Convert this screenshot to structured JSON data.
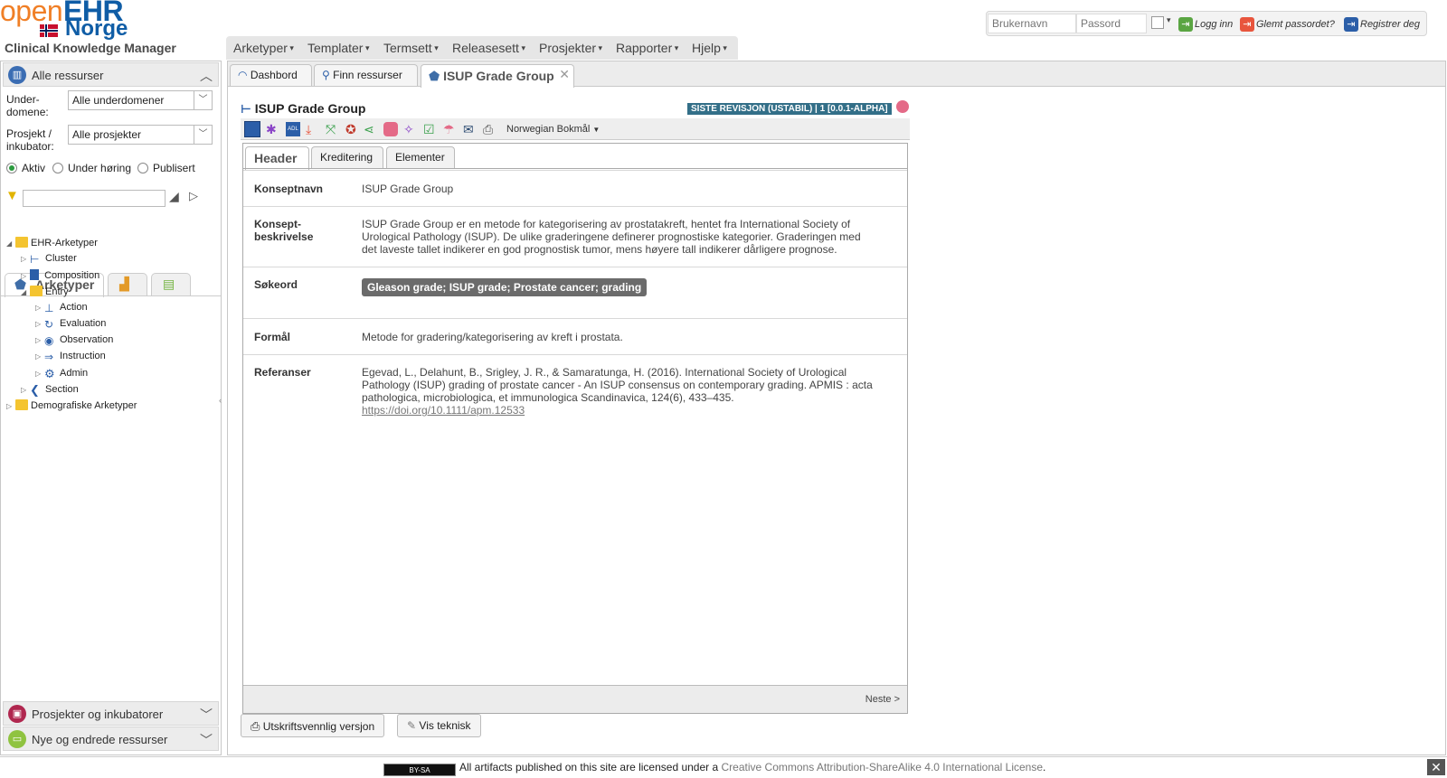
{
  "brand": {
    "logo_open": "open",
    "logo_ehr": "EHR",
    "logo_norge": "Norge",
    "app_title": "Clinical Knowledge Manager"
  },
  "login": {
    "username_placeholder": "Brukernavn",
    "password_placeholder": "Passord",
    "login_label": "Logg inn",
    "forgot_label": "Glemt passordet?",
    "register_label": "Registrer deg"
  },
  "menu": [
    "Arketyper",
    "Templater",
    "Termsett",
    "Releasesett",
    "Prosjekter",
    "Rapporter",
    "Hjelp"
  ],
  "left_panel": {
    "all_resources": "Alle ressurser",
    "subdomain_label": "Under-\ndomene:",
    "subdomain_value": "Alle underdomener",
    "project_label": "Prosjekt /\ninkubator:",
    "project_value": "Alle prosjekter",
    "radios": [
      {
        "label": "Aktiv",
        "checked": true
      },
      {
        "label": "Under høring",
        "checked": false
      },
      {
        "label": "Publisert",
        "checked": false
      }
    ],
    "tab_archetypes": "Arketyper",
    "tree": [
      {
        "label": "EHR-Arketyper",
        "icon": "folder-open-icon"
      },
      {
        "label": "Cluster",
        "icon": "cluster-icon"
      },
      {
        "label": "Composition",
        "icon": "composition-icon"
      },
      {
        "label": "Entry",
        "icon": "folder-open-icon"
      },
      {
        "label": "Action",
        "icon": "action-icon"
      },
      {
        "label": "Evaluation",
        "icon": "evaluation-icon"
      },
      {
        "label": "Observation",
        "icon": "observation-icon"
      },
      {
        "label": "Instruction",
        "icon": "instruction-icon"
      },
      {
        "label": "Admin",
        "icon": "gear-icon"
      },
      {
        "label": "Section",
        "icon": "section-icon"
      },
      {
        "label": "Demografiske Arketyper",
        "icon": "folder-icon"
      }
    ],
    "projects": "Prosjekter og inkubatorer",
    "new_changed": "Nye og endrede ressurser"
  },
  "tabs": {
    "dashboard": "Dashbord",
    "find": "Finn ressurser",
    "current": "ISUP Grade Group"
  },
  "doc": {
    "title": "ISUP Grade Group",
    "revision_badge": "SISTE REVISJON (USTABIL) | 1 [0.0.1-ALPHA]",
    "language": "Norwegian Bokmål",
    "subtabs": [
      "Header",
      "Kreditering",
      "Elementer"
    ],
    "fields": {
      "concept_name_label": "Konseptnavn",
      "concept_name": "ISUP Grade Group",
      "concept_desc_label": "Konsept-\nbeskrivelse",
      "concept_desc": "ISUP Grade Group er en metode for kategorisering av prostatakreft, hentet fra International Society of Urological Pathology (ISUP). De ulike graderingene definerer prognostiske kategorier. Graderingen med det laveste tallet indikerer en god prognostisk tumor, mens høyere tall indikerer dårligere prognose.",
      "keywords_label": "Søkeord",
      "keywords": "Gleason grade; ISUP grade; Prostate cancer; grading",
      "purpose_label": "Formål",
      "purpose": "Metode for gradering/kategorisering av kreft i prostata.",
      "references_label": "Referanser",
      "references": "Egevad, L., Delahunt, B., Srigley, J. R., & Samaratunga, H. (2016). International Society of Urological Pathology (ISUP) grading of prostate cancer - An ISUP consensus on contemporary grading. APMIS : acta pathologica, microbiologica, et immunologica Scandinavica, 124(6), 433–435.",
      "reference_link": "https://doi.org/10.1111/apm.12533"
    },
    "next": "Neste >",
    "print_btn": "Utskriftsvennlig versjon",
    "tech_btn": "Vis teknisk"
  },
  "footer": {
    "cc_badge": "BY-SA",
    "text": "All artifacts published on this site are licensed under a",
    "license_link": "Creative Commons Attribution-ShareAlike 4.0 International License",
    "period": "."
  },
  "colors": {
    "brand_orange": "#f07f26",
    "brand_blue": "#0f5da6",
    "badge": "#336f88",
    "keyword_chip": "#6b6b6b"
  }
}
